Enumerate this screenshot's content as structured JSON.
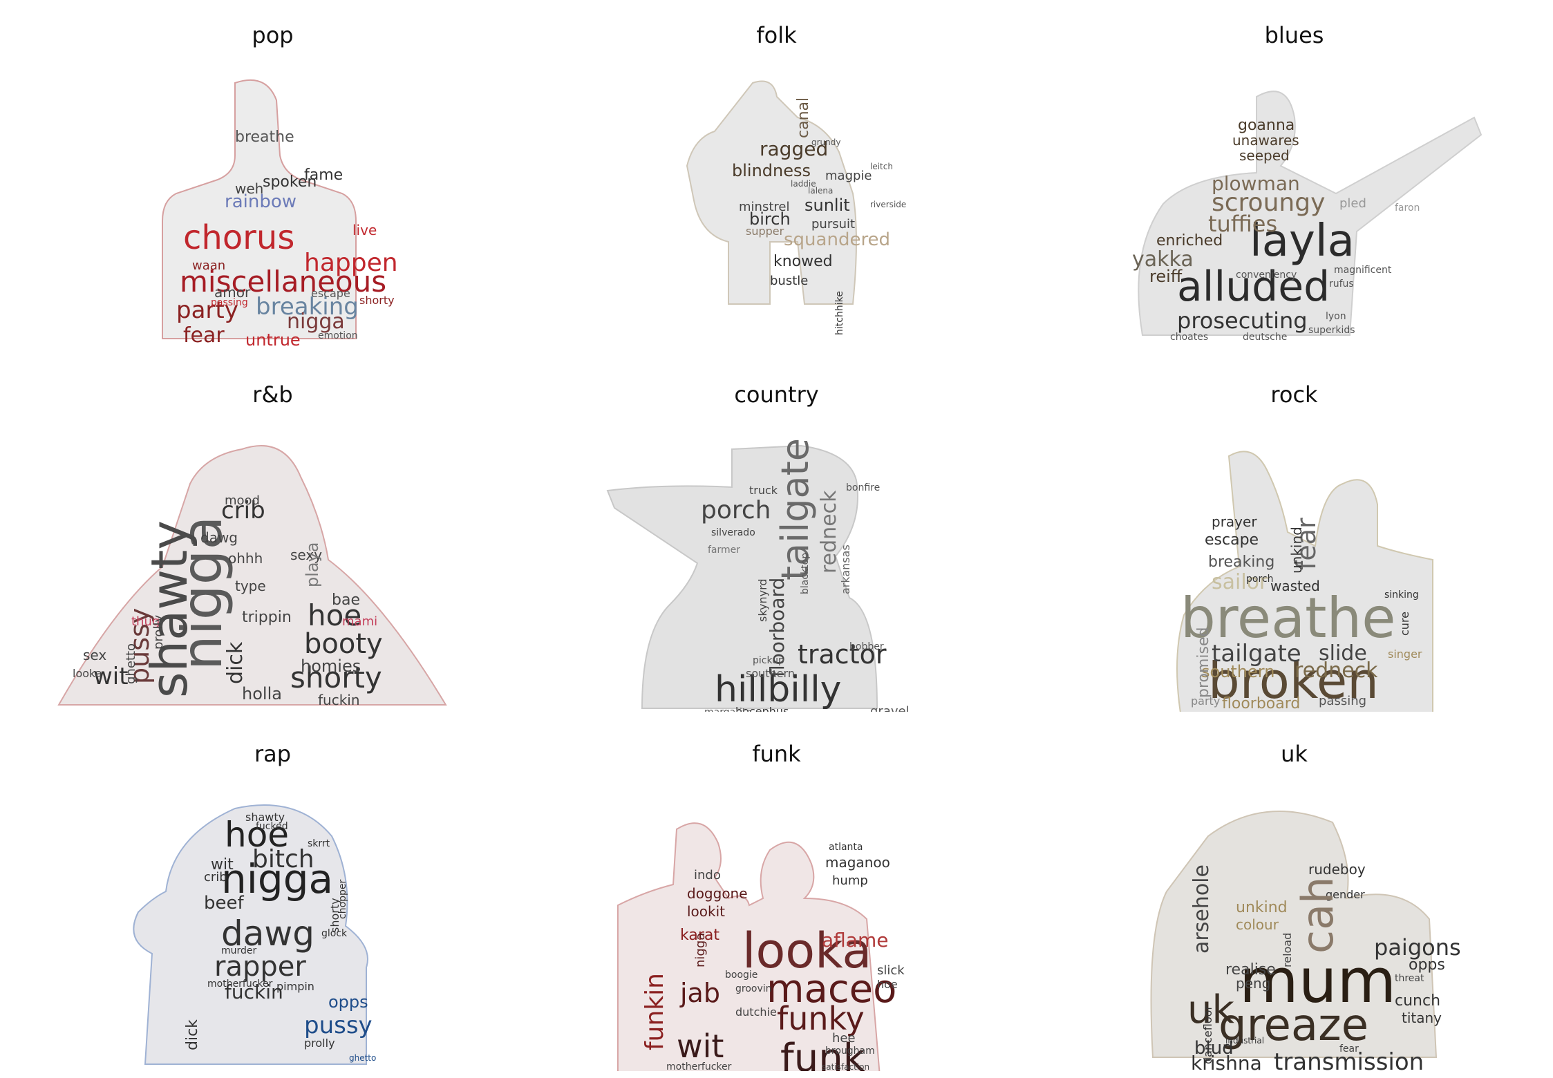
{
  "colors": {
    "grey": "#bfbfbf",
    "red": "#d43a3a",
    "dark": "#2a2a2a"
  },
  "panels": [
    {
      "title": "pop",
      "words": [
        "chorus",
        "miscellaneous",
        "breathe",
        "happen",
        "rainbow",
        "breaking",
        "party",
        "fear",
        "nigga",
        "fame",
        "spoken",
        "untrue",
        "amor",
        "weh",
        "shorty",
        "emotion",
        "waan",
        "escape",
        "passing",
        "live"
      ]
    },
    {
      "title": "folk",
      "words": [
        "ragged",
        "blindness",
        "sunlit",
        "birch",
        "minstrel",
        "pursuit",
        "knowed",
        "bustle",
        "hitchhike",
        "magpie",
        "squandered",
        "canal",
        "lalena",
        "grundy",
        "riverside",
        "leitch",
        "laddie",
        "supper"
      ]
    },
    {
      "title": "blues",
      "words": [
        "layla",
        "alluded",
        "prosecuting",
        "scroungy",
        "tuffies",
        "yakka",
        "plowman",
        "goanna",
        "unawares",
        "seeped",
        "enriched",
        "reiff",
        "conveniency",
        "magnificent",
        "rufus",
        "choates",
        "deutsche",
        "superkids",
        "lyon",
        "pled",
        "faron"
      ]
    },
    {
      "title": "r&b",
      "words": [
        "nigga",
        "shawty",
        "pussy",
        "booty",
        "shorty",
        "hoe",
        "crib",
        "wit",
        "dick",
        "homies",
        "holla",
        "fuckin",
        "trippin",
        "sexy",
        "bae",
        "mami",
        "thug",
        "ghetto",
        "type",
        "ohhh",
        "dawg",
        "playa",
        "mood",
        "sex",
        "looka",
        "prolly"
      ]
    },
    {
      "title": "country",
      "words": [
        "tailgate",
        "hillbilly",
        "tractor",
        "porch",
        "redneck",
        "floorboard",
        "truck",
        "silverado",
        "skynyrd",
        "bocephus",
        "gravel",
        "margarita",
        "bobber",
        "southern",
        "pickup",
        "arkansas",
        "blacktop",
        "bonfire",
        "farmer"
      ]
    },
    {
      "title": "rock",
      "words": [
        "breathe",
        "broken",
        "tailgate",
        "slide",
        "redneck",
        "southern",
        "floorboard",
        "passing",
        "prayer",
        "escape",
        "breaking",
        "sailor",
        "fear",
        "unkind",
        "wasted",
        "promised",
        "porch",
        "sinking",
        "singer",
        "party",
        "cure"
      ]
    },
    {
      "title": "rap",
      "words": [
        "nigga",
        "hoe",
        "bitch",
        "dawg",
        "rapper",
        "fuckin",
        "pussy",
        "opps",
        "wit",
        "beef",
        "crib",
        "shawty",
        "dick",
        "motherfucker",
        "glock",
        "shorty",
        "pimpin",
        "prolly",
        "chopper",
        "skrrt",
        "fucked",
        "murder",
        "ghetto"
      ]
    },
    {
      "title": "funk",
      "words": [
        "looka",
        "maceo",
        "funky",
        "funk",
        "jab",
        "wit",
        "aflame",
        "funkin",
        "karat",
        "doggone",
        "lookit",
        "indo",
        "maganoo",
        "hump",
        "atlanta",
        "slick",
        "hoe",
        "boogie",
        "groovin",
        "hee",
        "brougham",
        "dutchie",
        "motherfucker",
        "satisfaction",
        "nigga"
      ]
    },
    {
      "title": "uk",
      "words": [
        "mum",
        "greaze",
        "uk",
        "transmission",
        "krishna",
        "blud",
        "paigons",
        "cunch",
        "titany",
        "opps",
        "arsehole",
        "realise",
        "colour",
        "unkind",
        "rudeboy",
        "gender",
        "peng",
        "dancefloor",
        "cah",
        "industrial",
        "reload",
        "fear",
        "threat"
      ]
    }
  ]
}
